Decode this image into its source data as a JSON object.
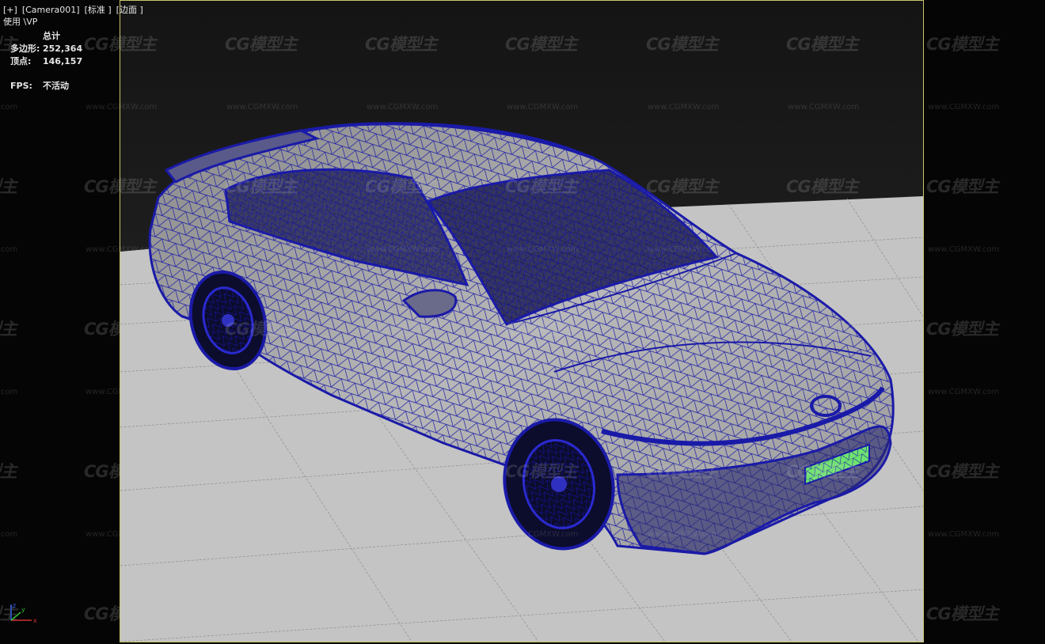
{
  "viewport": {
    "label_items": [
      "[+]",
      "[Camera001]",
      "[标准 ]",
      "[边面 ]"
    ],
    "mode": "使用 \\VP"
  },
  "stats": {
    "header": "总计",
    "polygons_label": "多边形:",
    "polygons_value": "252,364",
    "vertices_label": "顶点:",
    "vertices_value": "146,157",
    "fps_label": "FPS:",
    "fps_value": "不活动"
  },
  "watermark": {
    "logo_text": "CG模型主",
    "url_text": "www.CGMXW.com"
  },
  "gizmo": {
    "x_label": "x",
    "y_label": "y",
    "z_label": "z"
  },
  "colors": {
    "wire": "#1a1aa8",
    "frame": "#c9c56a",
    "floor": "#c4c4c4",
    "plate": "#6ee46e"
  }
}
